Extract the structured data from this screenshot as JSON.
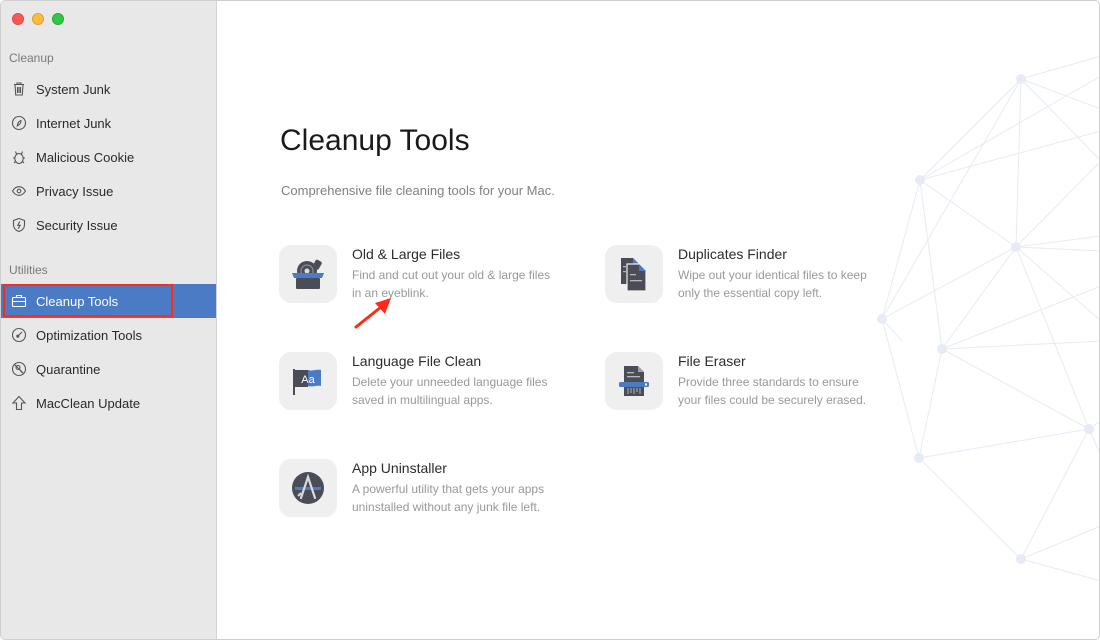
{
  "window": {
    "controls": [
      "close",
      "minimize",
      "maximize"
    ]
  },
  "sidebar": {
    "sections": [
      {
        "label": "Cleanup",
        "items": [
          {
            "label": "System Junk",
            "icon": "trash-icon"
          },
          {
            "label": "Internet Junk",
            "icon": "compass-leaf-icon"
          },
          {
            "label": "Malicious Cookie",
            "icon": "bug-icon"
          },
          {
            "label": "Privacy Issue",
            "icon": "eye-icon"
          },
          {
            "label": "Security Issue",
            "icon": "shield-icon"
          }
        ]
      },
      {
        "label": "Utilities",
        "items": [
          {
            "label": "Cleanup Tools",
            "icon": "toolbox-icon",
            "active": true
          },
          {
            "label": "Optimization Tools",
            "icon": "gauge-icon"
          },
          {
            "label": "Quarantine",
            "icon": "quarantine-icon"
          },
          {
            "label": "MacClean Update",
            "icon": "arrow-up-icon"
          }
        ]
      }
    ]
  },
  "main": {
    "title": "Cleanup Tools",
    "subtitle": "Comprehensive file cleaning tools for your Mac.",
    "tools": [
      {
        "name": "Old & Large Files",
        "desc": "Find and cut out your old & large files in an eyeblink.",
        "icon": "box-disc-icon"
      },
      {
        "name": "Duplicates Finder",
        "desc": "Wipe out your identical files to keep only the essential copy left.",
        "icon": "duplicate-files-icon"
      },
      {
        "name": "Language File Clean",
        "desc": "Delete your unneeded language files saved in multilingual apps.",
        "icon": "language-flag-icon"
      },
      {
        "name": "File Eraser",
        "desc": "Provide three standards to ensure your files could be securely erased.",
        "icon": "shredder-icon"
      },
      {
        "name": "App Uninstaller",
        "desc": "A powerful utility that gets your apps uninstalled without any junk file left.",
        "icon": "app-uninstall-icon"
      }
    ]
  },
  "colors": {
    "accent": "#4c7bc5",
    "highlight": "#ff2a1a",
    "sidebar_bg": "#e8e8e8",
    "icon_dark": "#4a4d57",
    "icon_blue": "#4c7bc5"
  }
}
